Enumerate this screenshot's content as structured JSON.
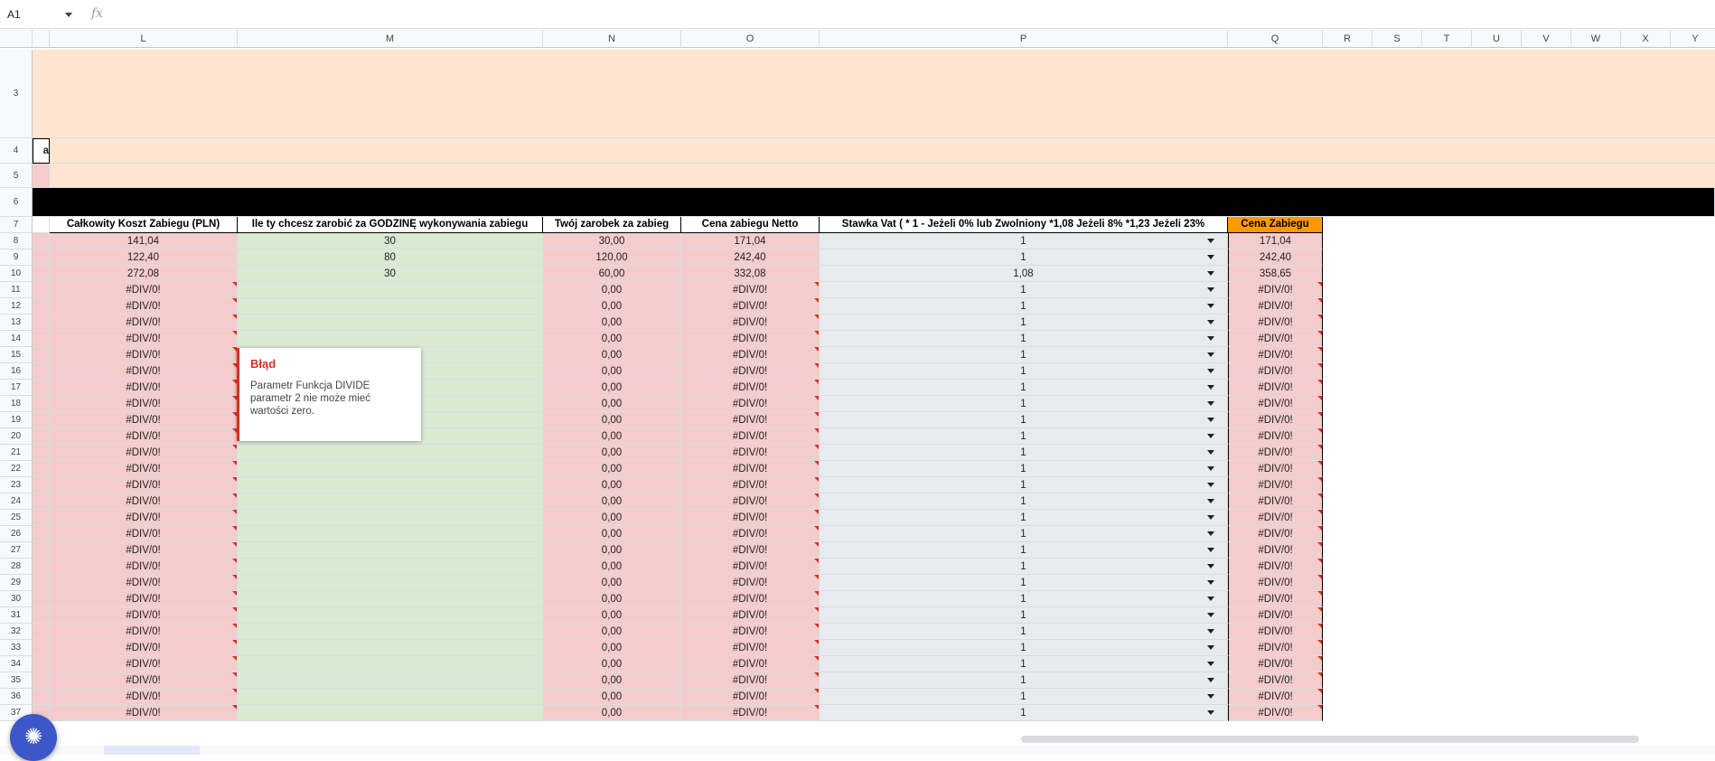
{
  "formula_bar": {
    "cell_ref": "A1",
    "fx_label": "fx",
    "formula": ""
  },
  "colors": {
    "peach": "#fde5d1",
    "black_bar": "#000000",
    "pink": "#f4cccc",
    "green": "#d9ead3",
    "gray": "#e8eaed",
    "orange_header": "#ff9900"
  },
  "columns": [
    "L",
    "M",
    "N",
    "O",
    "P",
    "Q",
    "R",
    "S",
    "T",
    "U",
    "V",
    "W",
    "X",
    "Y"
  ],
  "rows_top": [
    "3",
    "4",
    "5",
    "6",
    "7"
  ],
  "row4_partial": "a",
  "headers": {
    "L": "Całkowity Koszt Zabiegu (PLN)",
    "M": "Ile ty chcesz zarobić za GODZINĘ wykonywania zabiegu",
    "N": "Twój zarobek za zabieg",
    "O": "Cena zabiegu Netto",
    "P": "Stawka Vat ( * 1 - Jeżeli 0% lub Zwolniony *1,08 Jeżeli 8%   *1,23 Jeżeli 23%",
    "Q": "Cena Zabiegu"
  },
  "data_rows": [
    {
      "row": "8",
      "L": "141,04",
      "M": "30",
      "N": "30,00",
      "O": "171,04",
      "P": "1",
      "Q": "171,04"
    },
    {
      "row": "9",
      "L": "122,40",
      "M": "80",
      "N": "120,00",
      "O": "242,40",
      "P": "1",
      "Q": "242,40"
    },
    {
      "row": "10",
      "L": "272,08",
      "M": "30",
      "N": "60,00",
      "O": "332,08",
      "P": "1,08",
      "Q": "358,65"
    },
    {
      "row": "11",
      "L": "#DIV/0!",
      "M": "",
      "N": "0,00",
      "O": "#DIV/0!",
      "P": "1",
      "Q": "#DIV/0!"
    },
    {
      "row": "12",
      "L": "#DIV/0!",
      "M": "",
      "N": "0,00",
      "O": "#DIV/0!",
      "P": "1",
      "Q": "#DIV/0!"
    },
    {
      "row": "13",
      "L": "#DIV/0!",
      "M": "",
      "N": "0,00",
      "O": "#DIV/0!",
      "P": "1",
      "Q": "#DIV/0!"
    },
    {
      "row": "14",
      "L": "#DIV/0!",
      "M": "",
      "N": "0,00",
      "O": "#DIV/0!",
      "P": "1",
      "Q": "#DIV/0!"
    },
    {
      "row": "15",
      "L": "#DIV/0!",
      "M": "",
      "N": "0,00",
      "O": "#DIV/0!",
      "P": "1",
      "Q": "#DIV/0!"
    },
    {
      "row": "16",
      "L": "#DIV/0!",
      "M": "",
      "N": "0,00",
      "O": "#DIV/0!",
      "P": "1",
      "Q": "#DIV/0!"
    },
    {
      "row": "17",
      "L": "#DIV/0!",
      "M": "",
      "N": "0,00",
      "O": "#DIV/0!",
      "P": "1",
      "Q": "#DIV/0!"
    },
    {
      "row": "18",
      "L": "#DIV/0!",
      "M": "",
      "N": "0,00",
      "O": "#DIV/0!",
      "P": "1",
      "Q": "#DIV/0!"
    },
    {
      "row": "19",
      "L": "#DIV/0!",
      "M": "",
      "N": "0,00",
      "O": "#DIV/0!",
      "P": "1",
      "Q": "#DIV/0!"
    },
    {
      "row": "20",
      "L": "#DIV/0!",
      "M": "",
      "N": "0,00",
      "O": "#DIV/0!",
      "P": "1",
      "Q": "#DIV/0!"
    },
    {
      "row": "21",
      "L": "#DIV/0!",
      "M": "",
      "N": "0,00",
      "O": "#DIV/0!",
      "P": "1",
      "Q": "#DIV/0!"
    },
    {
      "row": "22",
      "L": "#DIV/0!",
      "M": "",
      "N": "0,00",
      "O": "#DIV/0!",
      "P": "1",
      "Q": "#DIV/0!"
    },
    {
      "row": "23",
      "L": "#DIV/0!",
      "M": "",
      "N": "0,00",
      "O": "#DIV/0!",
      "P": "1",
      "Q": "#DIV/0!"
    },
    {
      "row": "24",
      "L": "#DIV/0!",
      "M": "",
      "N": "0,00",
      "O": "#DIV/0!",
      "P": "1",
      "Q": "#DIV/0!"
    },
    {
      "row": "25",
      "L": "#DIV/0!",
      "M": "",
      "N": "0,00",
      "O": "#DIV/0!",
      "P": "1",
      "Q": "#DIV/0!"
    },
    {
      "row": "26",
      "L": "#DIV/0!",
      "M": "",
      "N": "0,00",
      "O": "#DIV/0!",
      "P": "1",
      "Q": "#DIV/0!"
    },
    {
      "row": "27",
      "L": "#DIV/0!",
      "M": "",
      "N": "0,00",
      "O": "#DIV/0!",
      "P": "1",
      "Q": "#DIV/0!"
    },
    {
      "row": "28",
      "L": "#DIV/0!",
      "M": "",
      "N": "0,00",
      "O": "#DIV/0!",
      "P": "1",
      "Q": "#DIV/0!"
    },
    {
      "row": "29",
      "L": "#DIV/0!",
      "M": "",
      "N": "0,00",
      "O": "#DIV/0!",
      "P": "1",
      "Q": "#DIV/0!"
    },
    {
      "row": "30",
      "L": "#DIV/0!",
      "M": "",
      "N": "0,00",
      "O": "#DIV/0!",
      "P": "1",
      "Q": "#DIV/0!"
    },
    {
      "row": "31",
      "L": "#DIV/0!",
      "M": "",
      "N": "0,00",
      "O": "#DIV/0!",
      "P": "1",
      "Q": "#DIV/0!"
    },
    {
      "row": "32",
      "L": "#DIV/0!",
      "M": "",
      "N": "0,00",
      "O": "#DIV/0!",
      "P": "1",
      "Q": "#DIV/0!"
    },
    {
      "row": "33",
      "L": "#DIV/0!",
      "M": "",
      "N": "0,00",
      "O": "#DIV/0!",
      "P": "1",
      "Q": "#DIV/0!"
    },
    {
      "row": "34",
      "L": "#DIV/0!",
      "M": "",
      "N": "0,00",
      "O": "#DIV/0!",
      "P": "1",
      "Q": "#DIV/0!"
    },
    {
      "row": "35",
      "L": "#DIV/0!",
      "M": "",
      "N": "0,00",
      "O": "#DIV/0!",
      "P": "1",
      "Q": "#DIV/0!"
    },
    {
      "row": "36",
      "L": "#DIV/0!",
      "M": "",
      "N": "0,00",
      "O": "#DIV/0!",
      "P": "1",
      "Q": "#DIV/0!"
    },
    {
      "row": "37",
      "L": "#DIV/0!",
      "M": "",
      "N": "0,00",
      "O": "#DIV/0!",
      "P": "1",
      "Q": "#DIV/0!"
    }
  ],
  "error_tooltip": {
    "title": "Błąd",
    "message": "Parametr Funkcja DIVIDE parametr 2 nie może mieć wartości zero."
  }
}
